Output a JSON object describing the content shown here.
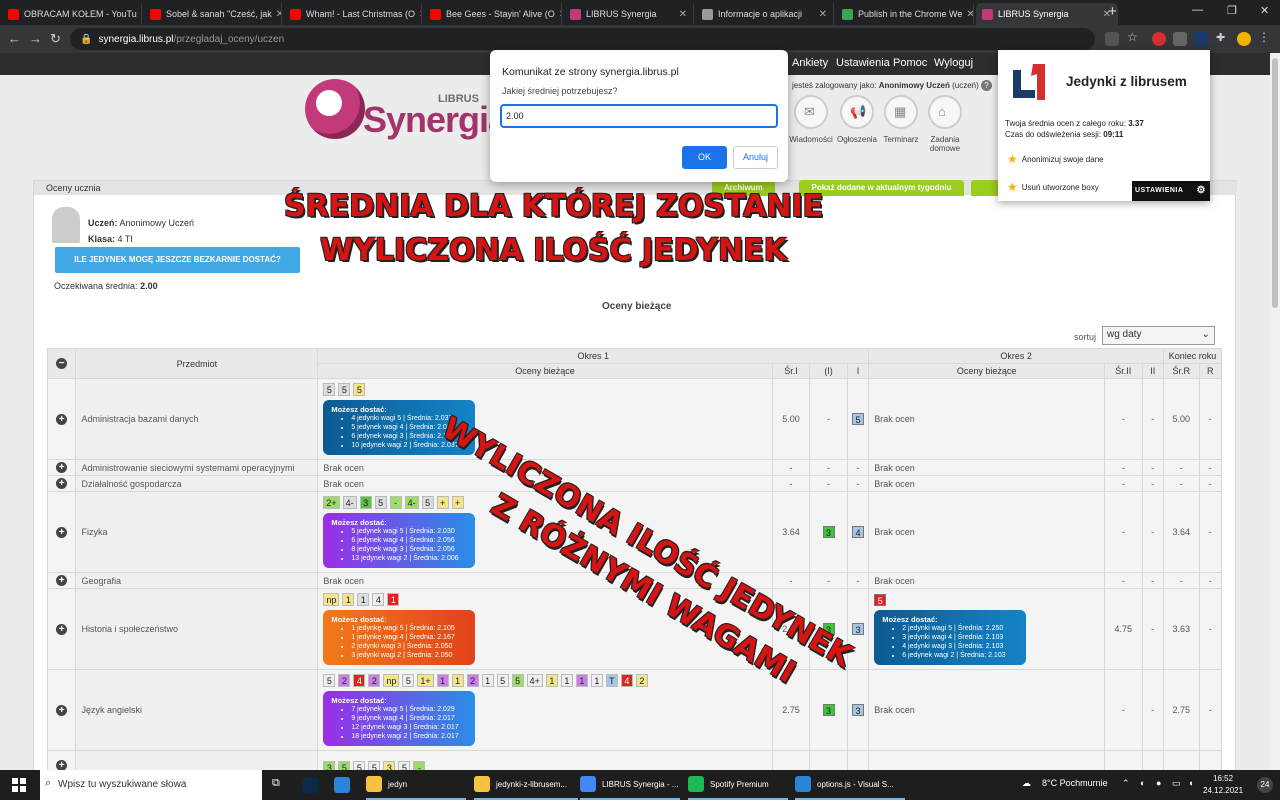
{
  "browser": {
    "tabs": [
      {
        "title": "OBRACAM KOŁEM - YouTu",
        "color": "#ff0000"
      },
      {
        "title": "Sobel & sanah \"Cześć, jak",
        "color": "#ff0000"
      },
      {
        "title": "Wham! - Last Christmas (O",
        "color": "#ff0000"
      },
      {
        "title": "Bee Gees - Stayin' Alive (O",
        "color": "#ff0000"
      },
      {
        "title": "LIBRUS Synergia",
        "color": "#c33a7b"
      },
      {
        "title": "Informacje o aplikacji",
        "color": "#999999"
      },
      {
        "title": "Publish in the Chrome We",
        "color": "#34a853"
      },
      {
        "title": "LIBRUS Synergia",
        "color": "#c33a7b",
        "active": true
      }
    ],
    "new_tab": "+",
    "url_host": "synergia.librus.pl",
    "url_path": "/przegladaj_oceny/uczen"
  },
  "librus": {
    "nav": [
      "Ankiety",
      "Ustawienia",
      "Pomoc",
      "Wyloguj"
    ],
    "brand": "LIBRUS",
    "logo_word": "Synergia",
    "logged_in_prefix": "jesteś zalogowany jako:",
    "logged_in_user": "Anonimowy Uczeń",
    "logged_in_role": "(uczeń)",
    "help_glyph": "?",
    "icons": [
      {
        "label": "Wiadomości",
        "glyph": "✉"
      },
      {
        "label": "Ogłoszenia",
        "glyph": "📢"
      },
      {
        "label": "Terminarz",
        "glyph": "▦"
      },
      {
        "label": "Zadania domowe",
        "glyph": "⌂"
      }
    ],
    "section_title": "Oceny ucznia",
    "tabs": [
      "Archiwum",
      "Pokaż dodane w aktualnym tygodniu"
    ],
    "student_label": "Uczeń:",
    "student_name": "Anonimowy Uczeń",
    "class_label": "Klasa:",
    "class_name": "4 TI",
    "ones_button": "ILE JEDYNEK MOGĘ JESZCZE BEZKARNIE DOSTAĆ?",
    "expected_label": "Oczekiwana średnia:",
    "expected_value": "2.00",
    "grades_title": "Oceny bieżące",
    "sort_label": "sortuj",
    "sort_value": "wg daty",
    "table_headers": {
      "subject": "Przedmiot",
      "period1": "Okres 1",
      "period2": "Okres 2",
      "year_end": "Koniec roku",
      "current": "Oceny bieżące",
      "avg1": "Śr.I",
      "prop1": "(I)",
      "final1": "I",
      "current2": "Oceny bieżące",
      "avg2": "Śr.II",
      "final2": "II",
      "avgR": "Śr.R",
      "finalR": "R"
    },
    "no_grades": "Brak ocen",
    "dash": "-",
    "popup_title": "Możesz dostać:",
    "rows": [
      {
        "subject": "Administracja bazami danych",
        "grades": [
          [
            "5",
            "gg"
          ],
          [
            "5",
            "gg"
          ],
          [
            "5",
            "gy"
          ]
        ],
        "popup_style": "pblue",
        "popup": [
          "4 jedynki wagi 5 | Średnia: 2.037",
          "5 jedynek wagi 4 | Średnia: 2.037",
          "6 jedynek wagi 3 | Średnia: 2.120",
          "10 jedynek wagi 2 | Średnia: 2.037"
        ],
        "avg1": "5.00",
        "prop1": "-",
        "final1": "5",
        "final1_style": "bl",
        "p2": "Brak ocen",
        "avg2": "-",
        "final2": "-",
        "avgR": "5.00",
        "finalR": "-"
      },
      {
        "subject": "Administrowanie sieciowymi systemami operacyjnymi",
        "grades": [],
        "p1text": "Brak ocen",
        "avg1": "-",
        "prop1": "-",
        "final1": "-",
        "p2": "Brak ocen",
        "avg2": "-",
        "final2": "-",
        "avgR": "-",
        "finalR": "-"
      },
      {
        "subject": "Działalność gospodarcza",
        "grades": [],
        "p1text": "Brak ocen",
        "avg1": "-",
        "prop1": "-",
        "final1": "-",
        "p2": "Brak ocen",
        "avg2": "-",
        "final2": "-",
        "avgR": "-",
        "finalR": "-"
      },
      {
        "subject": "Fizyka",
        "grades": [
          [
            "2+",
            "ggr"
          ],
          [
            "4-",
            "gg"
          ],
          [
            "3",
            "gdg"
          ],
          [
            "5",
            "gg"
          ],
          [
            "-",
            "ggr"
          ],
          [
            "4-",
            "ggr"
          ],
          [
            "5",
            "gg"
          ],
          [
            "+",
            "gy"
          ],
          [
            "+",
            "gy"
          ]
        ],
        "popup_style": "ppurp",
        "popup": [
          "5 jedynek wagi 5 | Średnia: 2.030",
          "6 jedynek wagi 4 | Średnia: 2.056",
          "8 jedynek wagi 3 | Średnia: 2.056",
          "13 jedynek wagi 2 | Średnia: 2.006"
        ],
        "avg1": "3.64",
        "prop1": "3",
        "prop1_style": "gn",
        "final1": "4",
        "final1_style": "bl",
        "p2": "Brak ocen",
        "avg2": "-",
        "final2": "-",
        "avgR": "3.64",
        "finalR": "-"
      },
      {
        "subject": "Geografia",
        "grades": [],
        "p1text": "Brak ocen",
        "avg1": "-",
        "prop1": "-",
        "final1": "-",
        "p2": "Brak ocen",
        "avg2": "-",
        "final2": "-",
        "avgR": "-",
        "finalR": "-"
      },
      {
        "subject": "Historia i społeczeństwo",
        "grades": [
          [
            "np",
            "gy"
          ],
          [
            "1",
            "gy"
          ],
          [
            "1",
            "gg"
          ],
          [
            "4",
            "gwh"
          ],
          [
            "1",
            "gr"
          ]
        ],
        "popup_style": "porng",
        "popup": [
          "1 jedynkę wagi 5 | Średnia: 2.105",
          "1 jedynkę wagi 4 | Średnia: 2.167",
          "2 jedynki wagi 3 | Średnia: 2.050",
          "3 jedynki wagi 2 | Średnia: 2.050"
        ],
        "avg1": "2.50",
        "prop1": "3",
        "prop1_style": "gn",
        "final1": "3",
        "final1_style": "bl",
        "p2grades": [
          [
            "5",
            "gr"
          ]
        ],
        "p2popup": [
          "2 jedynki wagi 5 | Średnia: 2.250",
          "3 jedynki wagi 4 | Średnia: 2.103",
          "4 jedynki wagi 3 | Średnia: 2.103",
          "6 jedynek wagi 2 | Średnia: 2.103"
        ],
        "avg2": "4.75",
        "final2": "-",
        "avgR": "3.63",
        "finalR": "-"
      },
      {
        "subject": "Język angielski",
        "grades": [
          [
            "5",
            "gwh"
          ],
          [
            "2",
            "gp"
          ],
          [
            "4",
            "gr"
          ],
          [
            "2",
            "gp"
          ],
          [
            "np",
            "gy"
          ],
          [
            "5",
            "gwh"
          ],
          [
            "1+",
            "gy"
          ],
          [
            "1",
            "gp"
          ],
          [
            "1",
            "gy"
          ],
          [
            "2",
            "gp"
          ],
          [
            "1",
            "gwh"
          ],
          [
            "5",
            "gwh"
          ],
          [
            "5",
            "ggr"
          ],
          [
            "4+",
            "gwh"
          ],
          [
            "1",
            "gy"
          ],
          [
            "1",
            "gwh"
          ],
          [
            "1",
            "gp"
          ],
          [
            "1",
            "gwh"
          ],
          [
            "T",
            "gb"
          ],
          [
            "4",
            "gr"
          ],
          [
            "2",
            "gy"
          ]
        ],
        "popup_style": "ppurp",
        "popup": [
          "7 jedynek wagi 5 | Średnia: 2.029",
          "9 jedynek wagi 4 | Średnia: 2.017",
          "12 jedynek wagi 3 | Średnia: 2.017",
          "18 jedynek wagi 2 | Średnia: 2.017"
        ],
        "avg1": "2.75",
        "prop1": "3",
        "prop1_style": "gn",
        "final1": "3",
        "final1_style": "bl",
        "p2": "Brak ocen",
        "avg2": "-",
        "final2": "-",
        "avgR": "2.75",
        "finalR": "-"
      },
      {
        "subject": "",
        "grades": [
          [
            "3",
            "ggr"
          ],
          [
            "5",
            "ggr"
          ],
          [
            "5",
            "gwh"
          ],
          [
            "5",
            "gwh"
          ],
          [
            "3",
            "gy"
          ],
          [
            "5",
            "gwh"
          ],
          [
            "-",
            "ggr"
          ]
        ],
        "popup_style": "ppurp",
        "popup": [],
        "avg1": "",
        "prop1": "",
        "final1": "",
        "p2": "",
        "avg2": "",
        "final2": "",
        "avgR": "",
        "finalR": ""
      }
    ]
  },
  "dialog": {
    "title": "Komunikat ze strony synergia.librus.pl",
    "question": "Jakiej średniej potrzebujesz?",
    "value": "2.00",
    "ok": "OK",
    "cancel": "Anuluj"
  },
  "extension": {
    "title": "Jedynki z librusem",
    "avg_label": "Twoja średnia ocen z całego roku:",
    "avg_value": "3.37",
    "refresh_label": "Czas do odświeżenia sesji:",
    "refresh_value": "09:11",
    "options": [
      "Anonimizuj swoje dane",
      "Usuń utworzone boxy"
    ],
    "settings": "USTAWIENIA"
  },
  "annotations": {
    "top_line1": "ŚREDNIA DLA KTÓREJ ZOSTANIE",
    "top_line2": "WYLICZONA ILOŚĆ JEDYNEK",
    "mid_line1": "WYLICZONA ILOŚĆ JEDYNEK",
    "mid_line2": "Z RÓŻNYMI WAGAMI"
  },
  "taskbar": {
    "search_placeholder": "Wpisz tu wyszukiwane słowa",
    "apps": [
      {
        "label": "jedyn",
        "color": "#f5c242"
      },
      {
        "label": "jedynki-z-librusem...",
        "color": "#f5c242"
      },
      {
        "label": "LIBRUS Synergia - ...",
        "color": "#4285f4"
      },
      {
        "label": "Spotify Premium",
        "color": "#1db954"
      },
      {
        "label": "options.js - Visual S...",
        "color": "#2a86d4"
      }
    ],
    "weather": "8°C  Pochmurnie",
    "time": "16:52",
    "date": "24.12.2021",
    "notif": "24"
  }
}
